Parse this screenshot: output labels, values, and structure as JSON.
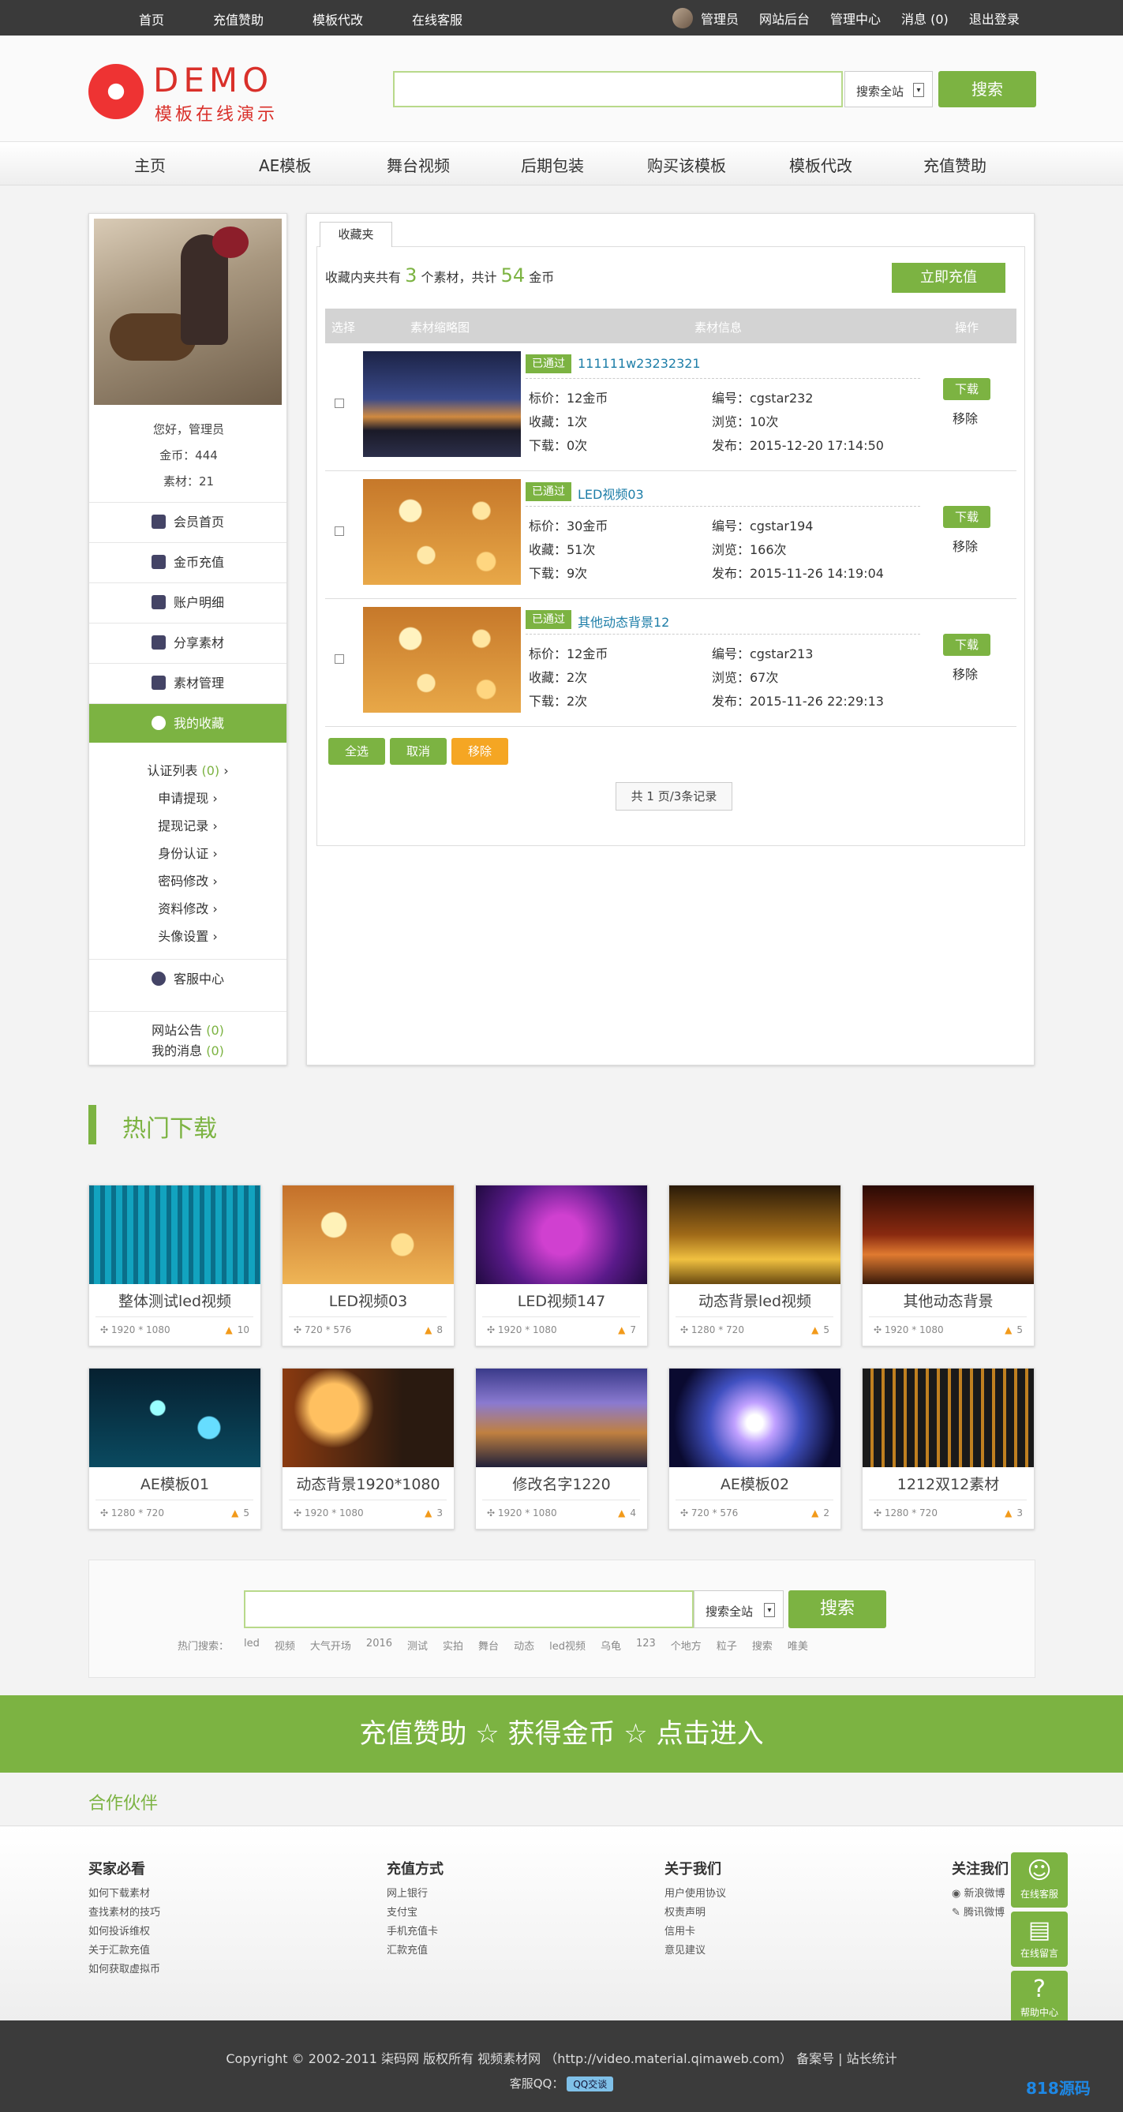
{
  "topbar": {
    "left": [
      "首页",
      "充值赞助",
      "模板代改",
      "在线客服"
    ],
    "user": "管理员",
    "right": [
      "网站后台",
      "管理中心",
      "消息 (0)",
      "退出登录"
    ]
  },
  "logo": {
    "title": "DEMO",
    "subtitle": "模板在线演示"
  },
  "header_search": {
    "scope": "搜索全站",
    "button": "搜索"
  },
  "nav": [
    "主页",
    "AE模板",
    "舞台视频",
    "后期包装",
    "购买该模板",
    "模板代改",
    "充值赞助"
  ],
  "side": {
    "greeting": "您好，管理员",
    "coins": "金币：444",
    "materials": "素材：21",
    "menu": [
      "会员首页",
      "金币充值",
      "账户明细",
      "分享素材",
      "素材管理",
      "我的收藏"
    ],
    "sub_first": "认证列表",
    "sub_first_count": "(0)",
    "sub": [
      "申请提现",
      "提现记录",
      "身份认证",
      "密码修改",
      "资料修改",
      "头像设置"
    ],
    "service": "客服中心",
    "notice": "网站公告",
    "notice_count": "(0)",
    "messages": "我的消息",
    "messages_count": "(0)"
  },
  "fav": {
    "tab": "收藏夹",
    "s1": "收藏内夹共有",
    "count": "3",
    "s2": "个素材，共计",
    "coins": "54",
    "s3": "金币",
    "recharge": "立即充值",
    "headers": [
      "选择",
      "素材缩略图",
      "素材信息",
      "操作"
    ],
    "items": [
      {
        "badge": "已通过",
        "name": "111111w23232321",
        "price": "标价：12金币",
        "id": "编号：cgstar232",
        "fav": "收藏：1次",
        "views": "浏览：10次",
        "dl": "下载：0次",
        "date": "发布：2015-12-20 17:14:50",
        "btn": "下载",
        "rm": "移除"
      },
      {
        "badge": "已通过",
        "name": "LED视频03",
        "price": "标价：30金币",
        "id": "编号：cgstar194",
        "fav": "收藏：51次",
        "views": "浏览：166次",
        "dl": "下载：9次",
        "date": "发布：2015-11-26 14:19:04",
        "btn": "下载",
        "rm": "移除"
      },
      {
        "badge": "已通过",
        "name": "其他动态背景12",
        "price": "标价：12金币",
        "id": "编号：cgstar213",
        "fav": "收藏：2次",
        "views": "浏览：67次",
        "dl": "下载：2次",
        "date": "发布：2015-11-26 22:29:13",
        "btn": "下载",
        "rm": "移除"
      }
    ],
    "select_all": "全选",
    "cancel": "取消",
    "remove": "移除",
    "pager": "共 1 页/3条记录"
  },
  "hot": {
    "title": "热门下载",
    "cards": [
      {
        "t": "整体测试led视频",
        "size": "1920 * 1080",
        "n": "10"
      },
      {
        "t": "LED视频03",
        "size": "720 * 576",
        "n": "8"
      },
      {
        "t": "LED视频147",
        "size": "1920 * 1080",
        "n": "7"
      },
      {
        "t": "动态背景led视频",
        "size": "1280 * 720",
        "n": "5"
      },
      {
        "t": "其他动态背景",
        "size": "1920 * 1080",
        "n": "5"
      },
      {
        "t": "AE模板01",
        "size": "1280 * 720",
        "n": "5"
      },
      {
        "t": "动态背景1920*1080",
        "size": "1920 * 1080",
        "n": "3"
      },
      {
        "t": "修改名字1220",
        "size": "1920 * 1080",
        "n": "4"
      },
      {
        "t": "AE模板02",
        "size": "720 * 576",
        "n": "2"
      },
      {
        "t": "1212双12素材",
        "size": "1280 * 720",
        "n": "3"
      }
    ]
  },
  "bottom_search": {
    "scope": "搜索全站",
    "button": "搜索",
    "label": "热门搜索：",
    "keywords": [
      "led",
      "视频",
      "大气开场",
      "2016",
      "测试",
      "实拍",
      "舞台",
      "动态",
      "led视频",
      "乌龟",
      "123",
      "个地方",
      "粒子",
      "搜索",
      "唯美"
    ]
  },
  "banner": "充值赞助 ☆ 获得金币 ☆ 点击进入",
  "partner": "合作伙伴",
  "footer": {
    "cols": [
      {
        "h": "买家必看",
        "items": [
          "如何下载素材",
          "查找素材的技巧",
          "如何投诉维权",
          "关于汇款充值",
          "如何获取虚拟币"
        ]
      },
      {
        "h": "充值方式",
        "items": [
          "网上银行",
          "支付宝",
          "手机充值卡",
          "汇款充值"
        ]
      },
      {
        "h": "关于我们",
        "items": [
          "用户使用协议",
          "权责声明",
          "信用卡",
          "意见建议"
        ]
      },
      {
        "h": "关注我们",
        "items": [
          "新浪微博",
          "腾讯微博"
        ]
      }
    ],
    "copyright": "Copyright © 2002-2011 柒码网 版权所有 视频素材网 （http://video.material.qimaweb.com） 备案号 | 站长统计",
    "service_qq": "客服QQ：",
    "qq_badge": "QQ交谈"
  },
  "float": [
    "在线客服",
    "在线留言",
    "帮助中心"
  ],
  "watermark": "818源码"
}
